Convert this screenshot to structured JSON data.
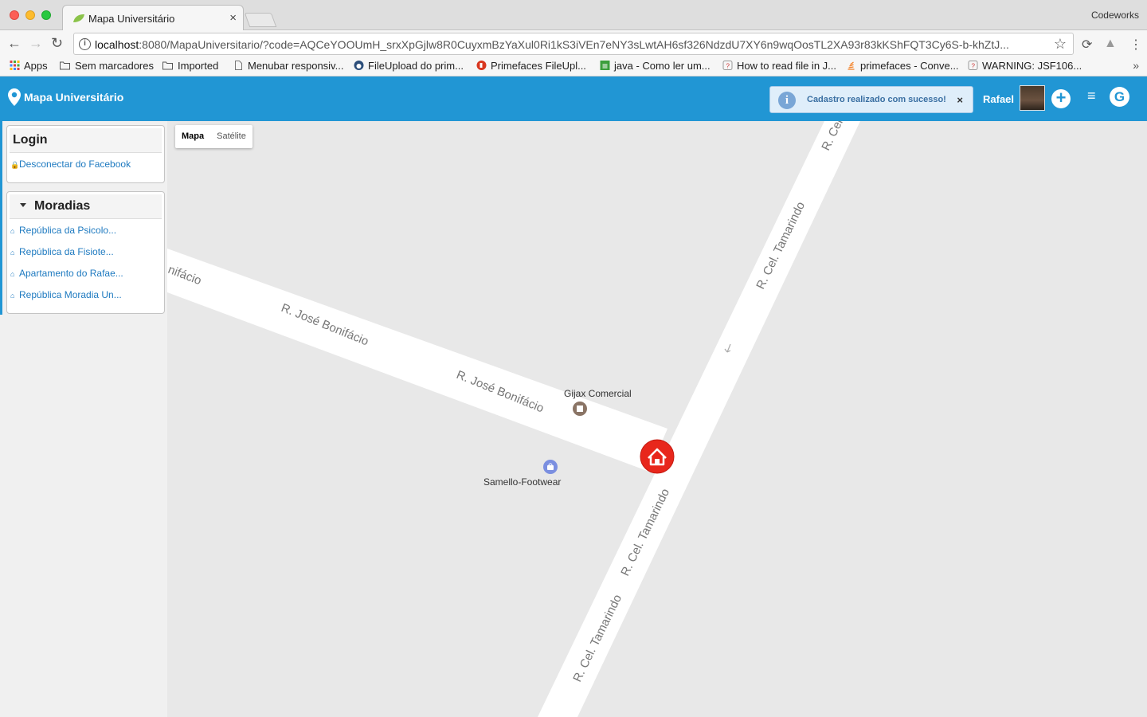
{
  "browser": {
    "tab_title": "Mapa Universitário",
    "tab_close": "×",
    "profile": "Codeworks",
    "url_host": "localhost",
    "url_rest": ":8080/MapaUniversitario/?code=AQCeYOOUmH_srxXpGjlw8R0CuyxmBzYaXul0Ri1kS3iVEn7eNY3sLwtAH6sf326NdzdU7XY6n9wqOosTL2XA93r83kKShFQT3Cy6S-b-khZtJ...",
    "bookmarks": [
      {
        "label": "Apps",
        "icon": "apps-grid-icon"
      },
      {
        "label": "Sem marcadores",
        "icon": "folder-icon"
      },
      {
        "label": "Imported",
        "icon": "folder-icon"
      },
      {
        "label": "Menubar responsiv...",
        "icon": "page-icon"
      },
      {
        "label": "FileUpload do prim...",
        "icon": "site-icon"
      },
      {
        "label": "Primefaces FileUpl...",
        "icon": "site-icon"
      },
      {
        "label": "java - Como ler um...",
        "icon": "stackoverflow-icon"
      },
      {
        "label": "How to read file in J...",
        "icon": "unknown-site-icon"
      },
      {
        "label": "primefaces - Conve...",
        "icon": "stackoverflow-icon"
      },
      {
        "label": "WARNING: JSF106...",
        "icon": "unknown-site-icon"
      }
    ],
    "bookmarks_more": "»"
  },
  "header": {
    "brand": "Mapa Universitário",
    "growl_message": "Cadastro realizado com sucesso!",
    "growl_close": "×",
    "user_name": "Rafael",
    "add_label": "+",
    "menu_label": "≡",
    "g_label": "G"
  },
  "sidebar": {
    "login_title": "Login",
    "logout_link": "Desconectar do Facebook",
    "moradias_title": "Moradias",
    "moradias": [
      "República da Psicolo...",
      "República da Fisiote...",
      "Apartamento do Rafae...",
      "República Moradia Un..."
    ]
  },
  "map": {
    "type_options": [
      "Mapa",
      "Satélite"
    ],
    "selected_type": "Mapa",
    "streets": {
      "jose_bonifacio": "R. José Bonifácio",
      "jose_bonifacio_partial": "nifácio",
      "tamarindo": "R. Cel. Tamarindo",
      "tamarindo_top": "R. Cel."
    },
    "pois": {
      "gijax": "Gijax Comercial",
      "samello": "Samello-Footwear"
    },
    "colors": {
      "marker": "#e8271c",
      "road": "#ffffff",
      "ground": "#e8e8e8"
    }
  }
}
